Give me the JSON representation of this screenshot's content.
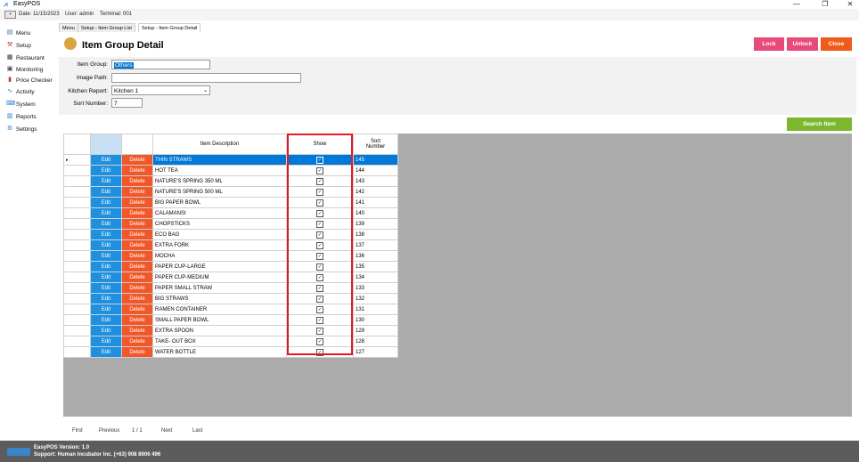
{
  "window": {
    "title": "EasyPOS",
    "minimize": "—",
    "restore": "❐",
    "close": "✕"
  },
  "info": {
    "date": "Date: 11/15/2023",
    "user": "User: admin",
    "terminal": "Terminal: 001"
  },
  "sidebar": {
    "items": [
      {
        "label": "Menu",
        "icon": "menu-book-icon"
      },
      {
        "label": "Setup",
        "icon": "setup-icon"
      },
      {
        "label": "Restaurant",
        "icon": "restaurant-icon"
      },
      {
        "label": "Monitoring",
        "icon": "monitoring-icon"
      },
      {
        "label": "Price Checker",
        "icon": "price-checker-icon"
      },
      {
        "label": "Activity",
        "icon": "activity-icon"
      },
      {
        "label": "System",
        "icon": "system-icon"
      },
      {
        "label": "Reports",
        "icon": "reports-icon"
      },
      {
        "label": "Settings",
        "icon": "settings-icon"
      }
    ]
  },
  "tabs": [
    "Menu",
    "Setup - Item Group List",
    "Setup - Item Group Detail"
  ],
  "page": {
    "title": "Item Group Detail"
  },
  "buttons": {
    "lock": "Lock",
    "unlock": "Unlock",
    "close": "Close",
    "search_item": "Search Item"
  },
  "colors": {
    "lock": "#e84a7a",
    "unlock": "#e84a7a",
    "close": "#f05a1a",
    "search": "#7cb82f",
    "edit": "#1e90e0",
    "delete": "#f2572a",
    "highlight": "#e31b23"
  },
  "form": {
    "item_group_label": "Item Group:",
    "item_group_value": "Others",
    "image_path_label": "Image Path:",
    "image_path_value": "",
    "kitchen_report_label": "Kitchen Report:",
    "kitchen_report_value": "Kitchen 1",
    "sort_number_label": "Sort Number:",
    "sort_number_value": "7"
  },
  "grid": {
    "headers": {
      "description": "Item Description",
      "show": "Show",
      "sort_line1": "Sort",
      "sort_line2": "Number"
    },
    "edit_label": "Edit",
    "delete_label": "Delete",
    "rows": [
      {
        "desc": "THIN STRAWS",
        "sort": "145",
        "show": true
      },
      {
        "desc": "HOT TEA",
        "sort": "144",
        "show": true
      },
      {
        "desc": "NATURE'S SPRING 350 ML",
        "sort": "143",
        "show": true
      },
      {
        "desc": "NATURE'S SPRING 500 ML",
        "sort": "142",
        "show": true
      },
      {
        "desc": "BIG PAPER BOWL",
        "sort": "141",
        "show": true
      },
      {
        "desc": "CALAMANSI",
        "sort": "140",
        "show": true
      },
      {
        "desc": "CHOPSTICKS",
        "sort": "139",
        "show": true
      },
      {
        "desc": "ECO BAG",
        "sort": "138",
        "show": true
      },
      {
        "desc": "EXTRA FORK",
        "sort": "137",
        "show": true
      },
      {
        "desc": "MOCHA",
        "sort": "136",
        "show": true
      },
      {
        "desc": "PAPER CUP-LARGE",
        "sort": "135",
        "show": true
      },
      {
        "desc": "PAPER CUP-MEDIUM",
        "sort": "134",
        "show": true
      },
      {
        "desc": "PAPER SMALL STRAW",
        "sort": "133",
        "show": true
      },
      {
        "desc": "BIG STRAWS",
        "sort": "132",
        "show": true
      },
      {
        "desc": "RAMEN CONTAINER",
        "sort": "131",
        "show": true
      },
      {
        "desc": "SMALL PAPER BOWL",
        "sort": "130",
        "show": true
      },
      {
        "desc": "EXTRA SPOON",
        "sort": "129",
        "show": true
      },
      {
        "desc": "TAKE- OUT BOX",
        "sort": "128",
        "show": true
      },
      {
        "desc": "WATER BOTTLE",
        "sort": "127",
        "show": true
      }
    ]
  },
  "pager": {
    "first": "First",
    "previous": "Previous",
    "page": "1 / 1",
    "next": "Next",
    "last": "Last"
  },
  "footer": {
    "version": "EasyPOS Version: 1.0",
    "support": "Support: Human Incubator Inc. (+63) 908 8906 496"
  }
}
